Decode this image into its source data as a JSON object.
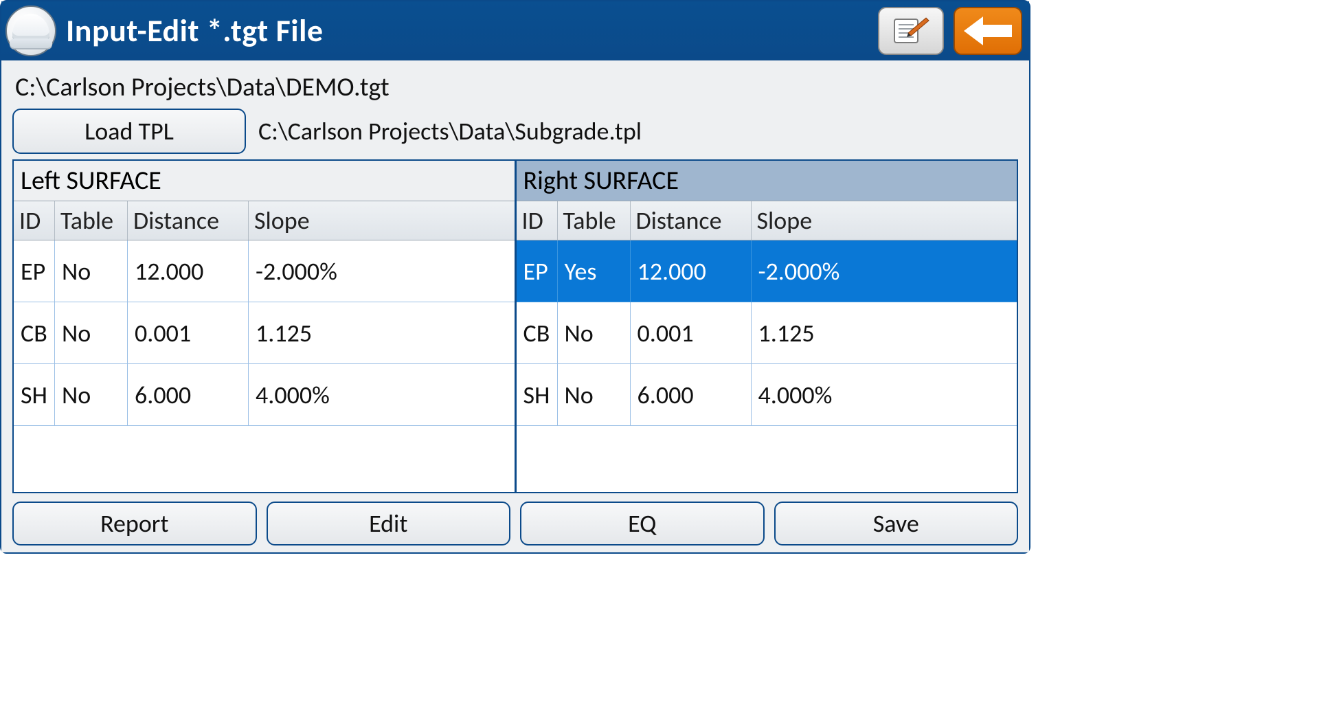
{
  "header": {
    "title": "Input-Edit *.tgt File"
  },
  "paths": {
    "tgt": "C:\\Carlson Projects\\Data\\DEMO.tgt",
    "tpl": "C:\\Carlson Projects\\Data\\Subgrade.tpl"
  },
  "buttons": {
    "load_tpl": "Load TPL",
    "report": "Report",
    "edit": "Edit",
    "eq": "EQ",
    "save": "Save"
  },
  "columns": {
    "id": "ID",
    "table": "Table",
    "distance": "Distance",
    "slope": "Slope"
  },
  "left": {
    "title": "Left SURFACE",
    "rows": [
      {
        "id": "EP",
        "table": "No",
        "distance": "12.000",
        "slope": "-2.000%",
        "selected": false
      },
      {
        "id": "CB",
        "table": "No",
        "distance": "0.001",
        "slope": "1.125",
        "selected": false
      },
      {
        "id": "SH",
        "table": "No",
        "distance": "6.000",
        "slope": "4.000%",
        "selected": false
      }
    ]
  },
  "right": {
    "title": "Right SURFACE",
    "rows": [
      {
        "id": "EP",
        "table": "Yes",
        "distance": "12.000",
        "slope": "-2.000%",
        "selected": true
      },
      {
        "id": "CB",
        "table": "No",
        "distance": "0.001",
        "slope": "1.125",
        "selected": false
      },
      {
        "id": "SH",
        "table": "No",
        "distance": "6.000",
        "slope": "4.000%",
        "selected": false
      }
    ]
  }
}
